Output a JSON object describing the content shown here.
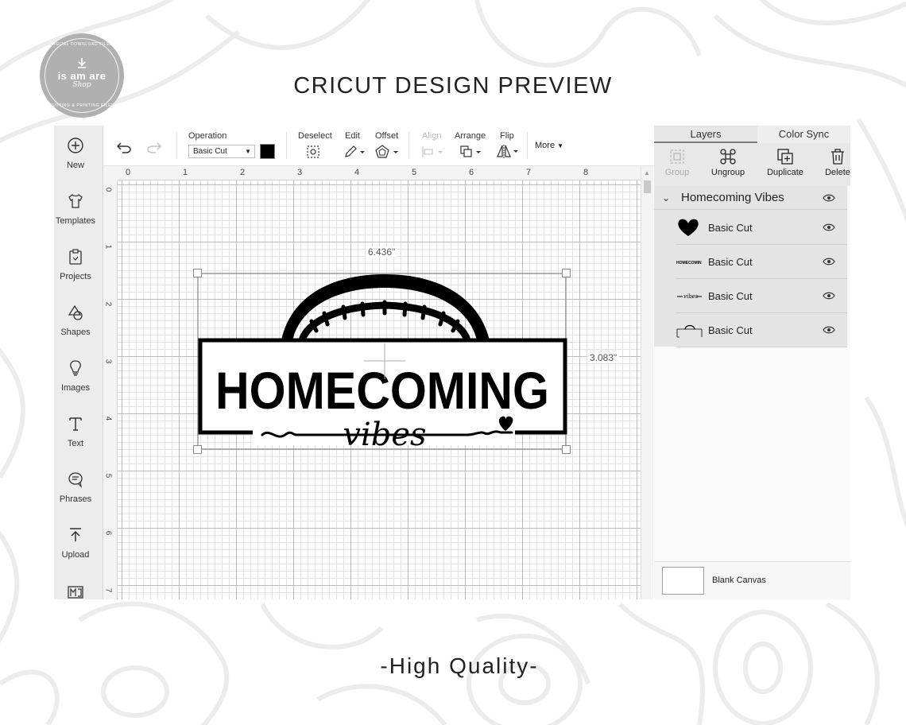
{
  "page": {
    "title": "CRICUT DESIGN PREVIEW",
    "footer": "-High Quality-"
  },
  "logo": {
    "brand": "is am are",
    "sub": "Shop",
    "arc_top": "DIGITAL DOWNLOAD FILES",
    "arc_bottom": "CUTTING & PRINTING FILES"
  },
  "sidebar": {
    "items": [
      {
        "label": "New",
        "icon": "plus-circle-icon"
      },
      {
        "label": "Templates",
        "icon": "tshirt-icon"
      },
      {
        "label": "Projects",
        "icon": "projects-icon"
      },
      {
        "label": "Shapes",
        "icon": "shapes-icon"
      },
      {
        "label": "Images",
        "icon": "lightbulb-icon"
      },
      {
        "label": "Text",
        "icon": "text-icon"
      },
      {
        "label": "Phrases",
        "icon": "speech-bubble-icon"
      },
      {
        "label": "Upload",
        "icon": "upload-icon"
      }
    ]
  },
  "toolbar": {
    "operation_label": "Operation",
    "operation_value": "Basic Cut",
    "operation_color": "#000000",
    "deselect_label": "Deselect",
    "edit_label": "Edit",
    "offset_label": "Offset",
    "align_label": "Align",
    "arrange_label": "Arrange",
    "flip_label": "Flip",
    "more_label": "More"
  },
  "rulers": {
    "top": [
      "0",
      "1",
      "2",
      "3",
      "4",
      "5",
      "6",
      "7",
      "8"
    ],
    "left": [
      "0",
      "1",
      "2",
      "3",
      "4",
      "5",
      "6",
      "7"
    ]
  },
  "design": {
    "line1": "HOMECOMING",
    "line2": "vibes",
    "width_label": "6.436\"",
    "height_label": "3.083\""
  },
  "panel": {
    "tabs": [
      "Layers",
      "Color Sync"
    ],
    "tools": [
      {
        "label": "Group",
        "enabled": false
      },
      {
        "label": "Ungroup",
        "enabled": true
      },
      {
        "label": "Duplicate",
        "enabled": true
      },
      {
        "label": "Delete",
        "enabled": true
      }
    ],
    "group_name": "Homecoming Vibes",
    "layers": [
      {
        "name": "Basic Cut",
        "thumb": "heart"
      },
      {
        "name": "Basic Cut",
        "thumb": "HOMECOMIN"
      },
      {
        "name": "Basic Cut",
        "thumb": "vibes"
      },
      {
        "name": "Basic Cut",
        "thumb": "football"
      }
    ],
    "blank_canvas_label": "Blank Canvas"
  }
}
